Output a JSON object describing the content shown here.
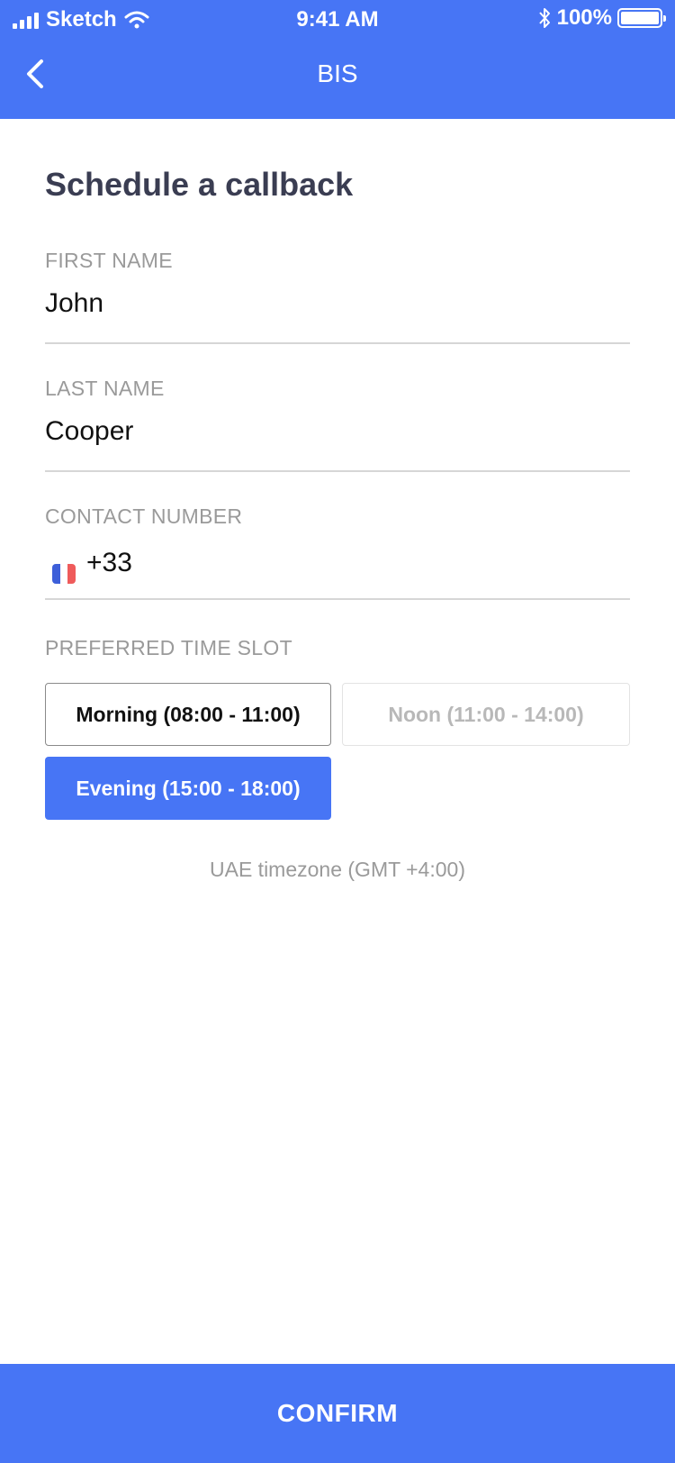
{
  "status_bar": {
    "carrier": "Sketch",
    "time": "9:41 AM",
    "battery": "100%"
  },
  "nav": {
    "title": "BIS",
    "back_icon": "chevron-left-icon"
  },
  "page_title": "Schedule a callback",
  "form": {
    "first_name": {
      "label": "FIRST NAME",
      "value": "John"
    },
    "last_name": {
      "label": "LAST NAME",
      "value": "Cooper"
    },
    "contact_number": {
      "label": "CONTACT NUMBER",
      "value": "+33",
      "flag": "france-flag-icon"
    }
  },
  "time_slot": {
    "label": "PREFERRED TIME SLOT",
    "options": [
      {
        "label": "Morning (08:00 - 11:00)",
        "state": "available"
      },
      {
        "label": "Noon (11:00 - 14:00)",
        "state": "disabled"
      },
      {
        "label": "Evening (15:00 - 18:00)",
        "state": "selected"
      }
    ]
  },
  "timezone_note": "UAE timezone (GMT +4:00)",
  "confirm_label": "CONFIRM",
  "colors": {
    "accent": "#4775F5",
    "title_text": "#3a3d52",
    "label_text": "#9a9a9a",
    "flag_blue": "#3d5fd9",
    "flag_white": "#ffffff",
    "flag_red": "#ef5b5b"
  }
}
